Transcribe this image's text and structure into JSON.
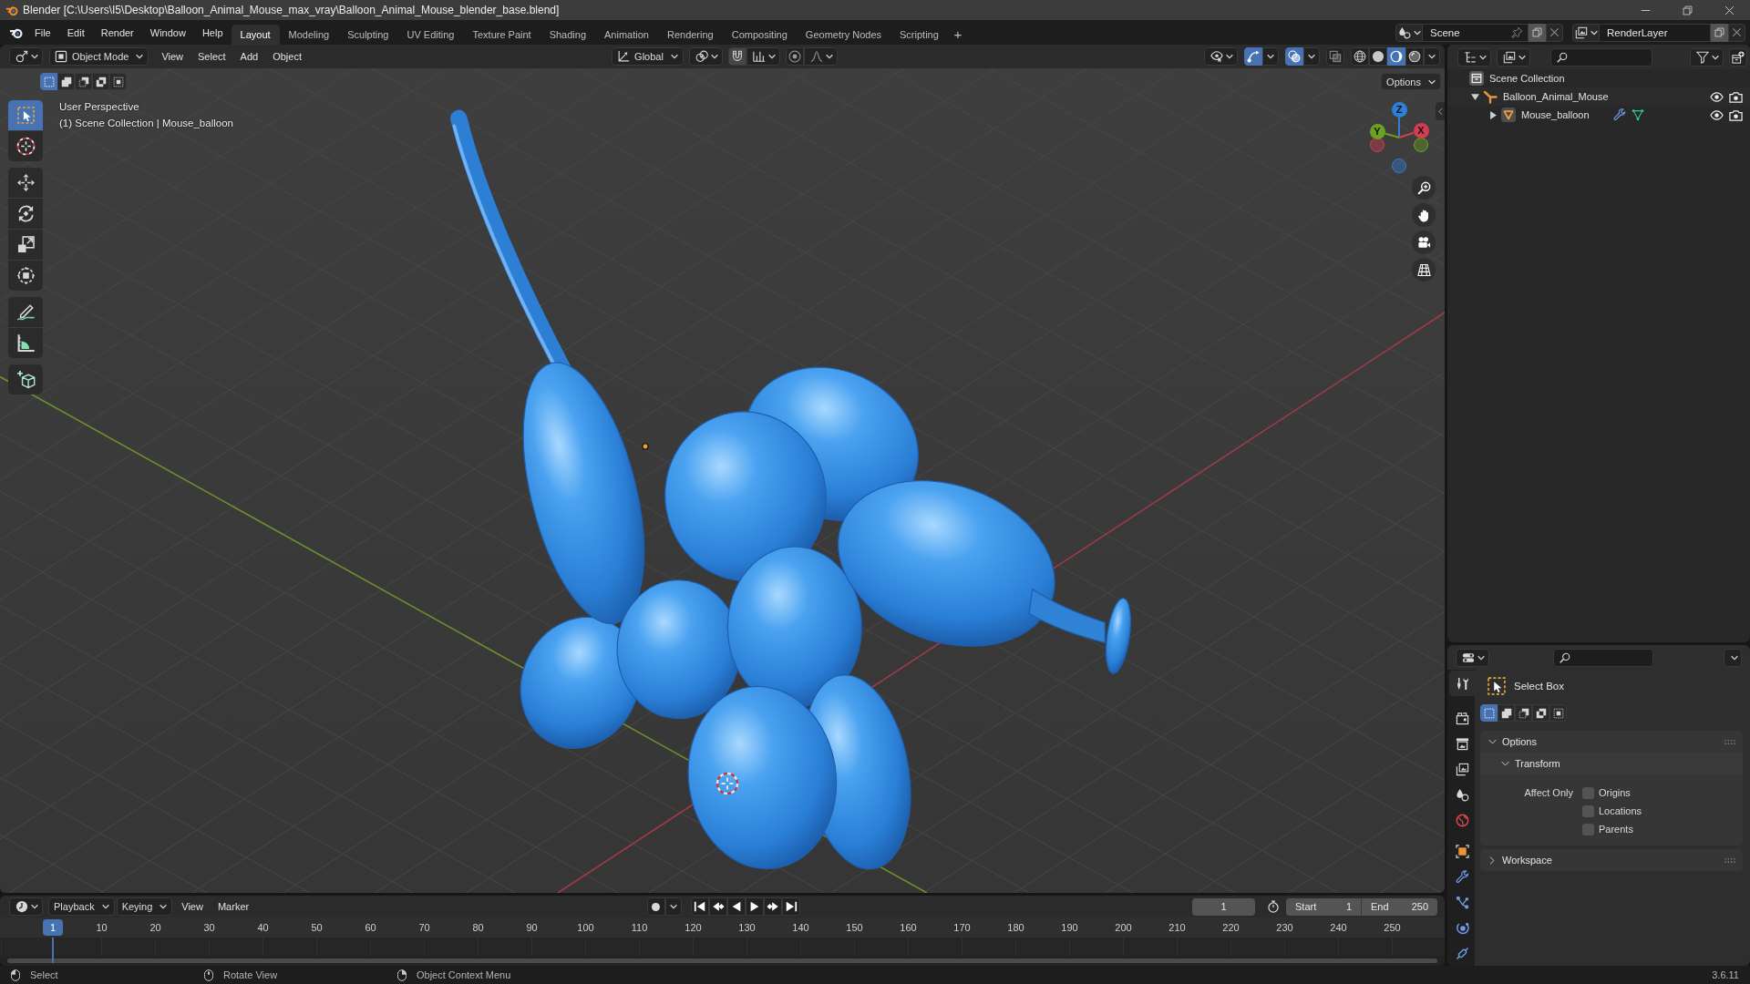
{
  "window": {
    "title": "Blender [C:\\Users\\I5\\Desktop\\Balloon_Animal_Mouse_max_vray\\Balloon_Animal_Mouse_blender_base.blend]"
  },
  "menu": [
    "File",
    "Edit",
    "Render",
    "Window",
    "Help"
  ],
  "workspaces": [
    {
      "label": "Layout",
      "selected": true
    },
    {
      "label": "Modeling",
      "selected": false
    },
    {
      "label": "Sculpting",
      "selected": false
    },
    {
      "label": "UV Editing",
      "selected": false
    },
    {
      "label": "Texture Paint",
      "selected": false
    },
    {
      "label": "Shading",
      "selected": false
    },
    {
      "label": "Animation",
      "selected": false
    },
    {
      "label": "Rendering",
      "selected": false
    },
    {
      "label": "Compositing",
      "selected": false
    },
    {
      "label": "Geometry Nodes",
      "selected": false
    },
    {
      "label": "Scripting",
      "selected": false
    }
  ],
  "add_workspace": "+",
  "scene": {
    "value": "Scene"
  },
  "view_layer": {
    "value": "RenderLayer"
  },
  "viewport": {
    "mode": "Object Mode",
    "menus": [
      "View",
      "Select",
      "Add",
      "Object"
    ],
    "orientation": "Global",
    "snapping": {
      "on": false
    },
    "proportional_editing": {
      "on": false
    },
    "toggles": [
      {
        "kind": "gizmos",
        "on": true
      },
      {
        "kind": "overlays",
        "on": true
      },
      {
        "kind": "xray",
        "on": false
      }
    ],
    "shading": [
      {
        "kind": "wireframe",
        "selected": false
      },
      {
        "kind": "solid",
        "selected": false
      },
      {
        "kind": "material",
        "selected": true
      },
      {
        "kind": "rendered",
        "selected": false
      }
    ],
    "select_modes": [
      {
        "kind": "set",
        "selected": true
      },
      {
        "kind": "extend",
        "selected": false
      },
      {
        "kind": "subtract",
        "selected": false
      },
      {
        "kind": "difference",
        "selected": false
      },
      {
        "kind": "intersect",
        "selected": false
      }
    ],
    "options": "Options",
    "info": [
      "User Perspective",
      "(1) Scene Collection | Mouse_balloon"
    ],
    "tool_groups": [
      [
        {
          "kind": "select_box",
          "selected": true
        },
        {
          "kind": "cursor",
          "selected": false
        }
      ],
      [
        {
          "kind": "move",
          "selected": false
        },
        {
          "kind": "rotate",
          "selected": false
        },
        {
          "kind": "scale",
          "selected": false
        },
        {
          "kind": "transform",
          "selected": false
        }
      ],
      [
        {
          "kind": "annotate",
          "selected": false
        },
        {
          "kind": "measure",
          "selected": false
        }
      ],
      [
        {
          "kind": "add_cube",
          "selected": false
        }
      ]
    ],
    "gizmo": [
      {
        "label": "Z",
        "color": "#2f7ed8"
      },
      {
        "label": "Y",
        "color": "#6ba31f"
      },
      {
        "label": "X",
        "color": "#d33d52"
      }
    ]
  },
  "outliner": {
    "items": [
      {
        "kind": "scene_collection",
        "label": "Scene Collection",
        "children": [
          {
            "kind": "collection",
            "label": "Balloon_Animal_Mouse",
            "expanded": true,
            "children": [
              {
                "kind": "mesh_object",
                "label": "Mouse_balloon",
                "expanded": false
              }
            ]
          }
        ]
      }
    ]
  },
  "properties": {
    "tabs": [
      {
        "kind": "tool",
        "selected": true
      },
      {
        "kind": "render",
        "selected": false
      },
      {
        "kind": "output",
        "selected": false
      },
      {
        "kind": "view_layer",
        "selected": false
      },
      {
        "kind": "scene",
        "selected": false
      },
      {
        "kind": "world",
        "selected": false
      },
      {
        "kind": "object",
        "selected": false
      },
      {
        "kind": "modifiers",
        "selected": false
      },
      {
        "kind": "particles",
        "selected": false
      },
      {
        "kind": "physics",
        "selected": false
      },
      {
        "kind": "constraints",
        "selected": false
      }
    ],
    "tool": "Select Box",
    "select_modes": [
      {
        "kind": "set",
        "selected": true
      },
      {
        "kind": "extend",
        "selected": false
      },
      {
        "kind": "subtract",
        "selected": false
      },
      {
        "kind": "difference",
        "selected": false
      },
      {
        "kind": "intersect",
        "selected": false
      }
    ],
    "panels": [
      {
        "title": "Options",
        "expanded": true,
        "subpanels": [
          {
            "title": "Transform",
            "expanded": true,
            "label": "Affect Only",
            "checkboxes": [
              {
                "label": "Origins",
                "checked": false
              },
              {
                "label": "Locations",
                "checked": false
              },
              {
                "label": "Parents",
                "checked": false
              }
            ]
          }
        ]
      },
      {
        "title": "Workspace",
        "expanded": false
      }
    ]
  },
  "timeline": {
    "menus": [
      {
        "kind": "dropdown",
        "label": "Playback"
      },
      {
        "kind": "dropdown",
        "label": "Keying"
      },
      {
        "kind": "menu",
        "label": "View"
      },
      {
        "kind": "menu",
        "label": "Marker"
      }
    ],
    "current_frame": "1",
    "start_label": "Start",
    "start": "1",
    "end_label": "End",
    "end": "250",
    "playhead": "1",
    "ruler": [
      "10",
      "20",
      "30",
      "40",
      "50",
      "60",
      "70",
      "80",
      "90",
      "100",
      "110",
      "120",
      "130",
      "140",
      "150",
      "160",
      "170",
      "180",
      "190",
      "200",
      "210",
      "220",
      "230",
      "240",
      "250"
    ]
  },
  "status": {
    "hints": [
      {
        "kind": "left",
        "label": "Select"
      },
      {
        "kind": "middle",
        "label": "Rotate View"
      },
      {
        "kind": "right",
        "label": "Object Context Menu"
      }
    ],
    "version": "3.6.11"
  }
}
